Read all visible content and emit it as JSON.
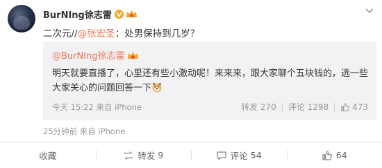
{
  "post": {
    "username": "BurNIng徐志雷",
    "text_prefix": "二次元//",
    "mention": "@张宏圣",
    "text_suffix": "：处男保持到几岁？",
    "time": "25分钟前",
    "source_label": "来自",
    "source": "iPhone"
  },
  "quote": {
    "username": "@BurNIng徐志雷",
    "text": "明天就要直播了，心里还有些小激动呢！来来来，跟大家聊个五块钱的，选一些大家关心的问题回答一下",
    "time": "今天 15:22",
    "source_label": "来自",
    "source": "iPhone",
    "repost_label": "转发",
    "repost_count": "270",
    "comment_label": "评论",
    "comment_count": "1298",
    "like_count": "473"
  },
  "actions": {
    "favorite_label": "收藏",
    "repost_label": "转发",
    "repost_count": "9",
    "comment_label": "评论",
    "comment_count": "54",
    "like_count": "64"
  },
  "colors": {
    "accent": "#eb7350",
    "verified": "#f5a623",
    "muted": "#999999"
  },
  "icons": [
    "verified-v-icon",
    "vip-crown-icon",
    "chevron-down-icon",
    "thumbs-up-icon",
    "repost-icon",
    "comment-icon",
    "dog-emoji-icon"
  ]
}
